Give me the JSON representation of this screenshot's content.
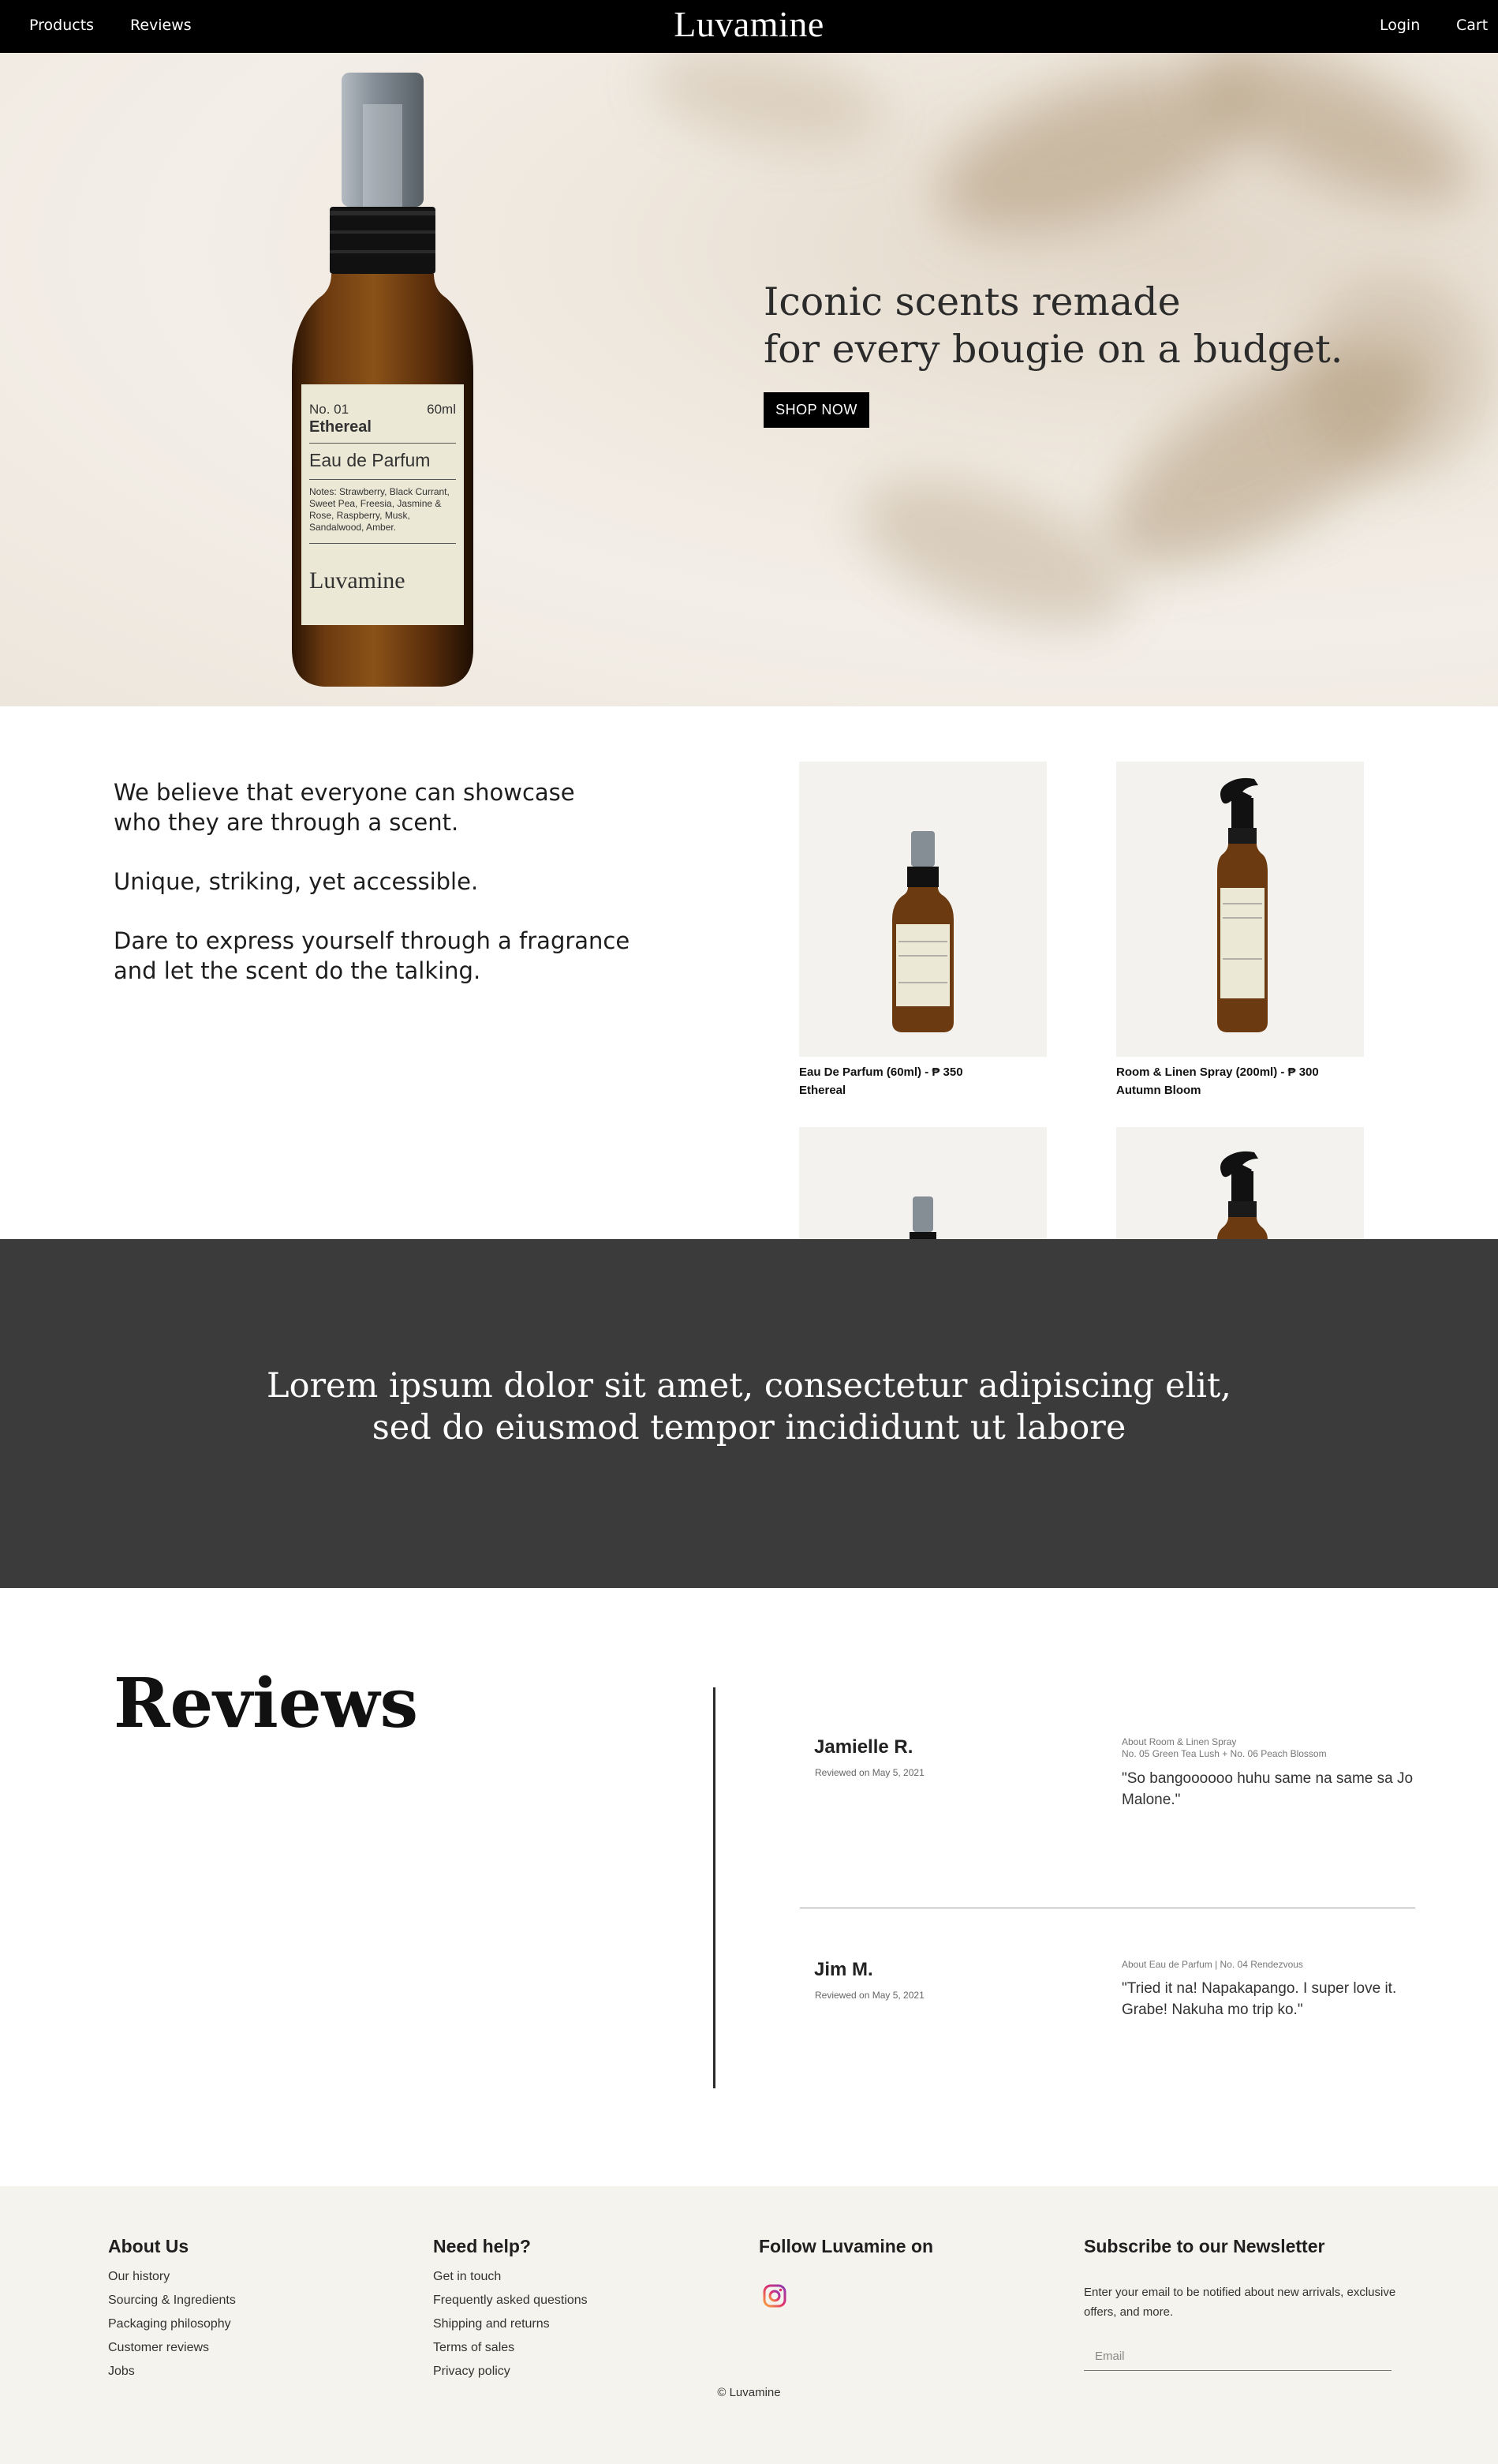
{
  "nav": {
    "brand": "Luvamine",
    "products_label": "Products",
    "reviews_label": "Reviews",
    "login_label": "Login",
    "cart_label": "Cart"
  },
  "hero": {
    "headline": "Iconic scents remade\nfor every bougie on a budget.",
    "cta_label": "SHOP NOW",
    "bottle_label": {
      "number": "No. 01",
      "volume": "60ml",
      "name": "Ethereal",
      "type": "Eau de Parfum",
      "notes": "Notes: Strawberry, Black Currant, Sweet Pea, Freesia, Jasmine & Rose, Raspberry, Musk, Sandalwood, Amber.",
      "brand": "Luvamine"
    }
  },
  "about": {
    "paragraphs": [
      "We believe that everyone can showcase\nwho they are through a scent.",
      "Unique, striking, yet accessible.",
      "Dare to express yourself through a fragrance\nand let the scent do the talking."
    ]
  },
  "products": [
    {
      "title": "Eau De Parfum (60ml) - ₱ 350",
      "name": "Ethereal"
    },
    {
      "title": "Room & Linen Spray (200ml) - ₱ 300",
      "name": "Autumn Bloom"
    }
  ],
  "band": {
    "quote": "Lorem ipsum dolor sit amet, consectetur adipiscing elit,\nsed do eiusmod tempor incididunt ut labore"
  },
  "reviews": {
    "title": "Reviews",
    "items": [
      {
        "name": "Jamielle R.",
        "date": "Reviewed on May 5, 2021",
        "about": "About Room & Linen Spray\nNo. 05 Green Tea Lush + No. 06 Peach Blossom",
        "quote": "\"So bangoooooo huhu same na same sa Jo Malone.\""
      },
      {
        "name": "Jim M.",
        "date": "Reviewed on May 5, 2021",
        "about": "About Eau de Parfum | No. 04 Rendezvous",
        "quote": "\"Tried it na! Napakapango. I super love it. Grabe! Nakuha mo trip ko.\""
      }
    ]
  },
  "footer": {
    "about_head": "About Us",
    "about_links": [
      "Our history",
      "Sourcing & Ingredients",
      "Packaging philosophy",
      "Customer reviews",
      "Jobs"
    ],
    "help_head": "Need help?",
    "help_links": [
      "Get in touch",
      "Frequently asked questions",
      "Shipping and returns",
      "Terms of sales",
      "Privacy policy"
    ],
    "follow_head": "Follow Luvamine on",
    "newsletter_head": "Subscribe to our Newsletter",
    "newsletter_note": "Enter your email to be notified about new arrivals, exclusive offers, and more.",
    "email_placeholder": "Email",
    "copyright": "© Luvamine",
    "social_icon": "instagram-icon"
  },
  "colors": {
    "nav_bg": "#000000",
    "band_bg": "#3b3b3b",
    "footer_bg": "#f5f3ed",
    "amber": "#6b3a10"
  }
}
